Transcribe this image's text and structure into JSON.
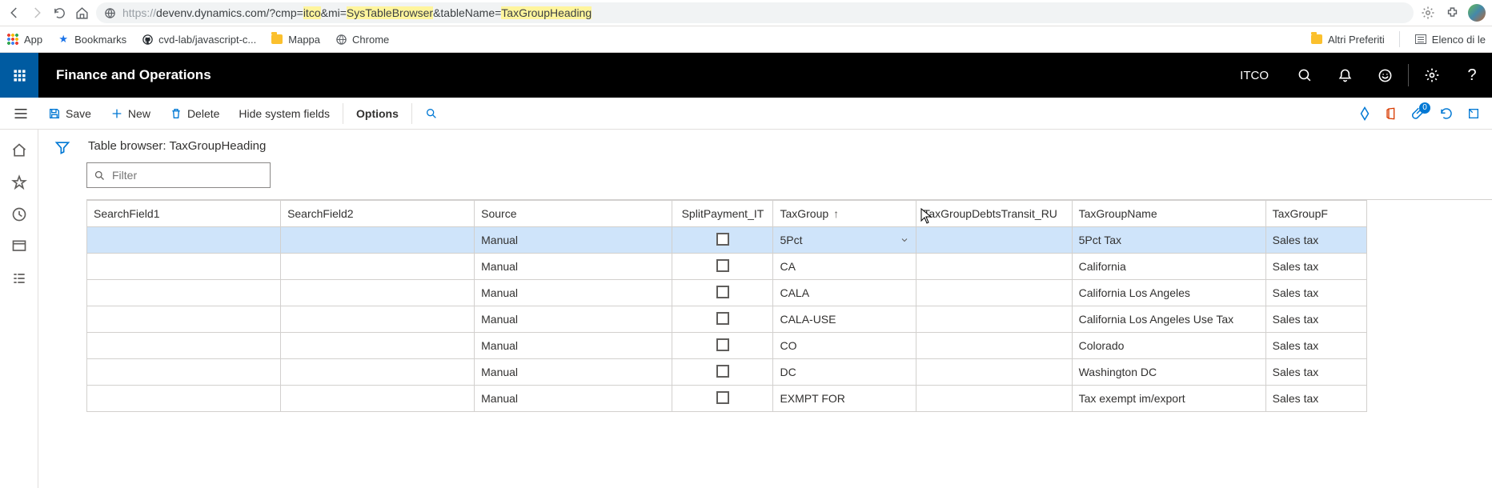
{
  "browser": {
    "url_prefix": "https://",
    "url_host": "devenv.dynamics.com",
    "url_q1": "/?cmp=",
    "url_h1": "itco",
    "url_q2": "&mi=",
    "url_h2": "SysTableBrowser",
    "url_q3": "&tableName=",
    "url_h3": "TaxGroupHeading"
  },
  "bookmarks": {
    "app": "App",
    "bm": "Bookmarks",
    "cvd": "cvd-lab/javascript-c...",
    "mappa": "Mappa",
    "chrome": "Chrome",
    "altri": "Altri Preferiti",
    "elenco": "Elenco di le"
  },
  "header": {
    "title": "Finance and Operations",
    "company": "ITCO"
  },
  "action": {
    "save": "Save",
    "new": "New",
    "delete": "Delete",
    "hide": "Hide system fields",
    "options": "Options",
    "badge": "0"
  },
  "page": {
    "title": "Table browser: TaxGroupHeading",
    "filter_placeholder": "Filter"
  },
  "columns": {
    "c0": "SearchField1",
    "c1": "SearchField2",
    "c2": "Source",
    "c3": "SplitPayment_IT",
    "c4": "TaxGroup",
    "c5": "TaxGroupDebtsTransit_RU",
    "c6": "TaxGroupName",
    "c7": "TaxGroupF"
  },
  "rows": [
    {
      "source": "Manual",
      "taxgroup": "5Pct",
      "name": "5Pct Tax",
      "rounding": "Sales tax"
    },
    {
      "source": "Manual",
      "taxgroup": "CA",
      "name": "California",
      "rounding": "Sales tax"
    },
    {
      "source": "Manual",
      "taxgroup": "CALA",
      "name": "California Los Angeles",
      "rounding": "Sales tax"
    },
    {
      "source": "Manual",
      "taxgroup": "CALA-USE",
      "name": "California  Los Angeles Use Tax",
      "rounding": "Sales tax"
    },
    {
      "source": "Manual",
      "taxgroup": "CO",
      "name": "Colorado",
      "rounding": "Sales tax"
    },
    {
      "source": "Manual",
      "taxgroup": "DC",
      "name": "Washington DC",
      "rounding": "Sales tax"
    },
    {
      "source": "Manual",
      "taxgroup": "EXMPT FOR",
      "name": "Tax exempt im/export",
      "rounding": "Sales tax"
    }
  ]
}
